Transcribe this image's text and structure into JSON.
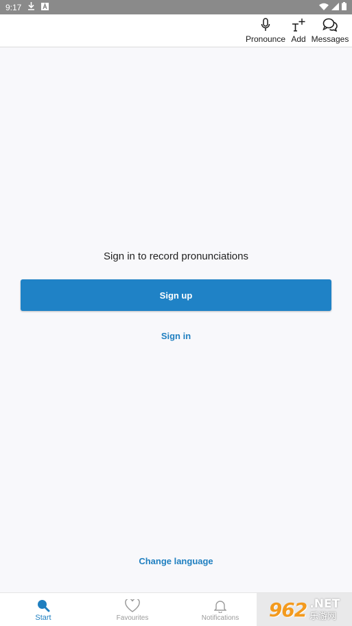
{
  "status_bar": {
    "time": "9:17",
    "icons": [
      "download-icon",
      "app-icon",
      "wifi-icon",
      "signal-icon",
      "battery-icon"
    ]
  },
  "top_bar": {
    "actions": [
      {
        "label": "Pronounce",
        "icon": "microphone-icon"
      },
      {
        "label": "Add",
        "icon": "add-text-icon"
      },
      {
        "label": "Messages",
        "icon": "chat-bubbles-icon"
      }
    ]
  },
  "main": {
    "prompt": "Sign in to record pronunciations",
    "signup_label": "Sign up",
    "signin_label": "Sign in",
    "change_language_label": "Change language"
  },
  "bottom_nav": {
    "items": [
      {
        "label": "Start",
        "icon": "search-icon",
        "active": true
      },
      {
        "label": "Favourites",
        "icon": "heart-icon",
        "active": false
      },
      {
        "label": "Notifications",
        "icon": "bell-icon",
        "active": false
      }
    ]
  },
  "watermark": {
    "number": "962",
    "net": ".NET",
    "chinese": "乐游网"
  },
  "colors": {
    "accent": "#1f82c6",
    "link": "#1f7fc0",
    "background": "#f8f8fb",
    "status_bar": "#8a8a8a",
    "inactive": "#9a9a9a"
  }
}
